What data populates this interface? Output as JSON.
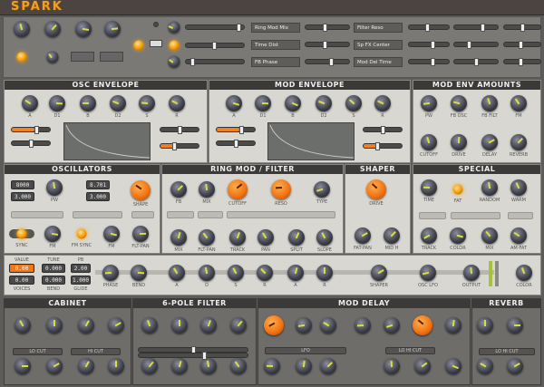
{
  "app": {
    "title": "SPARK",
    "accent": "#f08020"
  },
  "top": {
    "knobs": [
      "",
      "",
      "",
      ""
    ],
    "dropdowns": [
      "Ring Mod Mix",
      "Time Dist",
      "FB Phase",
      "Filter Reso",
      "Sp FX Center",
      "Mod Del Time"
    ]
  },
  "osc_env": {
    "title": "OSC ENVELOPE",
    "knobs": [
      "A",
      "D1",
      "B",
      "D2",
      "S",
      "R"
    ]
  },
  "mod_env": {
    "title": "MOD ENVELOPE",
    "knobs": [
      "A",
      "D1",
      "B",
      "D2",
      "S",
      "R"
    ]
  },
  "mod_amounts": {
    "title": "MOD ENV AMOUNTS",
    "knobs": [
      "PW",
      "FB OSC",
      "FB FILT",
      "FM",
      "CUTOFF",
      "DRIVE",
      "DELAY",
      "REVERB"
    ]
  },
  "oscillators": {
    "title": "OSCILLATORS",
    "displays": [
      "8000",
      "3.000",
      "8.701",
      "3.000"
    ],
    "knobs": [
      "PW",
      "SHAPE",
      "SYNC",
      "FM",
      "FM SYNC",
      "FM",
      "FLT-PAN"
    ]
  },
  "ringmod": {
    "title": "RING MOD / FILTER",
    "knobs": [
      "FB",
      "MIX",
      "CUTOFF",
      "RESO",
      "TYPE",
      "MIX",
      "FLT-PAN",
      "TRACK",
      "PAN",
      "SPLIT",
      "SLOPE"
    ]
  },
  "shaper": {
    "title": "SHAPER",
    "knobs": [
      "DRIVE",
      "FAT-PAN",
      "MID H"
    ]
  },
  "special": {
    "title": "SPECIAL",
    "knobs": [
      "TIME",
      "FAT",
      "RANDOM",
      "WARM",
      "TRACK",
      "COLOR",
      "MIX",
      "AM-FAT"
    ]
  },
  "strip": {
    "displays": [
      {
        "label": "VALUE",
        "top": "0.00",
        "bottom": "0.00",
        "sub": "VOICES"
      },
      {
        "label": "TUNE",
        "top": "0.000",
        "bottom": "0.000",
        "sub": "BEND"
      },
      {
        "label": "PB",
        "top": "2.00",
        "bottom": "1.000",
        "sub": "GLIDE"
      }
    ],
    "knobs": [
      "PHASE",
      "BEND",
      "A",
      "D",
      "S",
      "R",
      "A",
      "R",
      "SHAPER",
      "OSC LFO",
      "OUTPUT",
      "COLOR"
    ]
  },
  "cabinet": {
    "title": "CABINET",
    "bars": [
      "LO CUT",
      "HI CUT"
    ]
  },
  "pole6": {
    "title": "6-POLE FILTER"
  },
  "moddelay": {
    "title": "MOD DELAY",
    "bars": [
      "LFO",
      "LO HI CUT"
    ]
  },
  "reverb": {
    "title": "REVERB",
    "bars": [
      "LO HI CUT"
    ]
  }
}
